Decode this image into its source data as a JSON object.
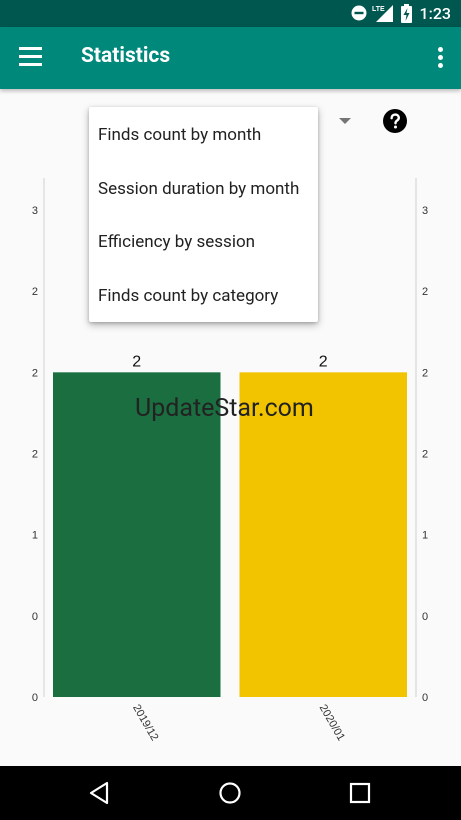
{
  "status_bar": {
    "time": "1:23",
    "network_label": "LTE",
    "icons": [
      "do-not-disturb-icon",
      "lte-signal-icon",
      "battery-charging-icon"
    ]
  },
  "app_bar": {
    "title": "Statistics",
    "icons": [
      "hamburger-menu-icon",
      "more-vert-icon"
    ]
  },
  "controls": {
    "icons": [
      "dropdown-arrow-icon",
      "help-icon"
    ]
  },
  "dropdown": {
    "items": [
      "Finds count by month",
      "Session duration by month",
      "Efficiency by session",
      "Finds count by category"
    ]
  },
  "watermark": "UpdateStar.com",
  "colors": {
    "status_bar": "#00574f",
    "app_bar": "#00897b",
    "bar_1": "#1a6e40",
    "bar_2": "#f2c400",
    "axis": "#d0d0d0"
  },
  "chart_data": {
    "type": "bar",
    "categories": [
      "2019/12",
      "2020/01"
    ],
    "values": [
      2,
      2
    ],
    "data_labels": [
      "2",
      "2"
    ],
    "left_tick_labels": [
      "0",
      "0",
      "1",
      "2",
      "2",
      "2",
      "3"
    ],
    "right_tick_labels": [
      "0",
      "0",
      "1",
      "2",
      "2",
      "2",
      "3"
    ],
    "ylim": [
      0,
      3
    ],
    "grid": false,
    "colors": [
      "#1a6e40",
      "#f2c400"
    ]
  },
  "nav_bar": {
    "icons": [
      "back-icon",
      "home-icon",
      "recents-icon"
    ]
  }
}
